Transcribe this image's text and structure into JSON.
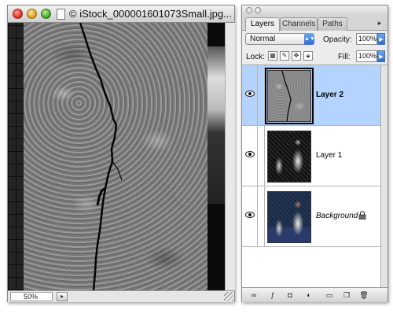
{
  "document": {
    "title": "© iStock_000001601073Small.jpg...",
    "zoom": "50%"
  },
  "palette": {
    "tabs": [
      {
        "label": "Layers",
        "active": true
      },
      {
        "label": "Channels",
        "active": false
      },
      {
        "label": "Paths",
        "active": false
      }
    ],
    "blend_mode": "Normal",
    "opacity_label": "Opacity:",
    "opacity_value": "100%",
    "lock_label": "Lock:",
    "fill_label": "Fill:",
    "fill_value": "100%",
    "layers": [
      {
        "name": "Layer 2",
        "selected": true,
        "visible": true
      },
      {
        "name": "Layer 1",
        "selected": false,
        "visible": true
      },
      {
        "name": "Background",
        "selected": false,
        "visible": true,
        "locked": true
      }
    ],
    "footer_icons": [
      "link-layers-icon",
      "layer-style-icon",
      "layer-mask-icon",
      "adjustment-layer-icon",
      "group-folder-icon",
      "new-layer-icon",
      "trash-icon"
    ]
  },
  "colors": {
    "selected_row": "#b5d3ff",
    "accent_blue": "#2f6dcc"
  }
}
